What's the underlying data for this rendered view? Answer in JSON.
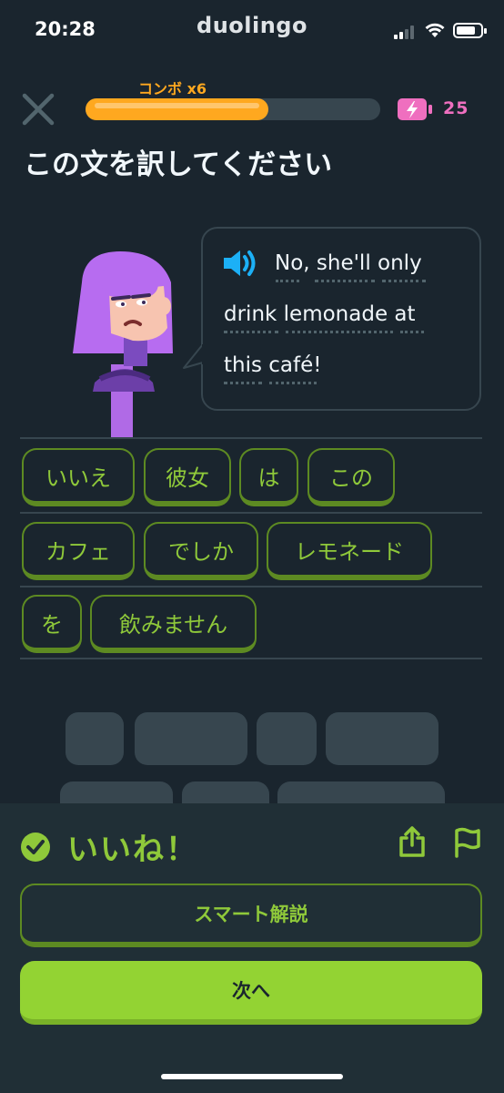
{
  "status_bar": {
    "time": "20:28",
    "app_name": "duolingo"
  },
  "header": {
    "combo_label": "コンボ x6",
    "progress": 0.62,
    "energy_count": "25",
    "close_icon": "close-icon",
    "energy_icon": "battery-bolt-icon"
  },
  "instruction": "この文を訳してください",
  "speech_bubble": {
    "speaker_icon": "speaker-icon",
    "lines": [
      "No, she'll only",
      "drink lemonade at",
      "this café!"
    ]
  },
  "word_bank": [
    {
      "label": "いいえ"
    },
    {
      "label": "彼女"
    },
    {
      "label": "は"
    },
    {
      "label": "この"
    },
    {
      "label": "カフェ"
    },
    {
      "label": "でしか"
    },
    {
      "label": "レモネード"
    },
    {
      "label": "を"
    },
    {
      "label": "飲みません"
    }
  ],
  "feedback": {
    "title": "いいね！",
    "check_icon": "check-circle-icon",
    "share_icon": "share-icon",
    "flag_icon": "flag-icon",
    "explain_button": "スマート解説",
    "next_button": "次へ"
  },
  "colors": {
    "background": "#1a252e",
    "accent_green": "#8fc93a",
    "button_green": "#93d333",
    "combo_orange": "#ffa81f",
    "energy_pink": "#ef6fbf"
  }
}
